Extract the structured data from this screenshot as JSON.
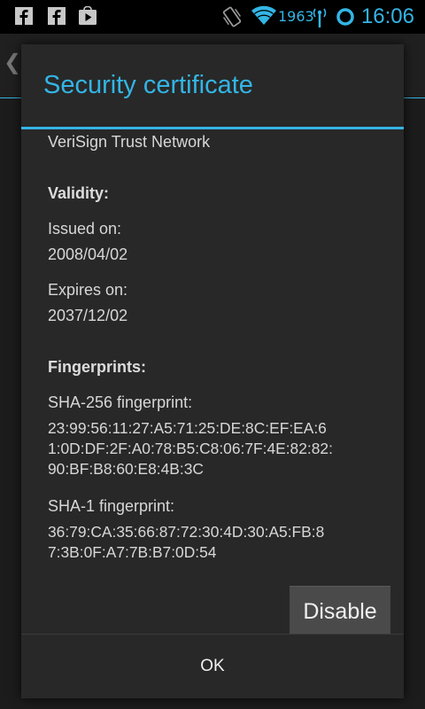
{
  "status_bar": {
    "notification_icons": [
      "facebook-icon",
      "facebook-icon",
      "play-store-icon"
    ],
    "status_icons": [
      "vibrate-icon",
      "wifi-icon",
      "data-icon",
      "sync-icon"
    ],
    "signal_text": "1963",
    "clock": "16:06",
    "accent_color": "#33b5e5"
  },
  "dialog": {
    "title": "Security certificate",
    "issuer_line": "VeriSign Trust Network",
    "validity": {
      "heading": "Validity:",
      "issued_label": "Issued on:",
      "issued_value": "2008/04/02",
      "expires_label": "Expires on:",
      "expires_value": "2037/12/02"
    },
    "fingerprints": {
      "heading": "Fingerprints:",
      "sha256_label": "SHA-256 fingerprint:",
      "sha256_lines": [
        "23:99:56:11:27:A5:71:25:DE:8C:EF:EA:6",
        "1:0D:DF:2F:A0:78:B5:C8:06:7F:4E:82:82:",
        "90:BF:B8:60:E8:4B:3C"
      ],
      "sha1_label": "SHA-1 fingerprint:",
      "sha1_lines": [
        "36:79:CA:35:66:87:72:30:4D:30:A5:FB:8",
        "7:3B:0F:A7:7B:B7:0D:54"
      ]
    },
    "disable_label": "Disable",
    "ok_label": "OK"
  }
}
